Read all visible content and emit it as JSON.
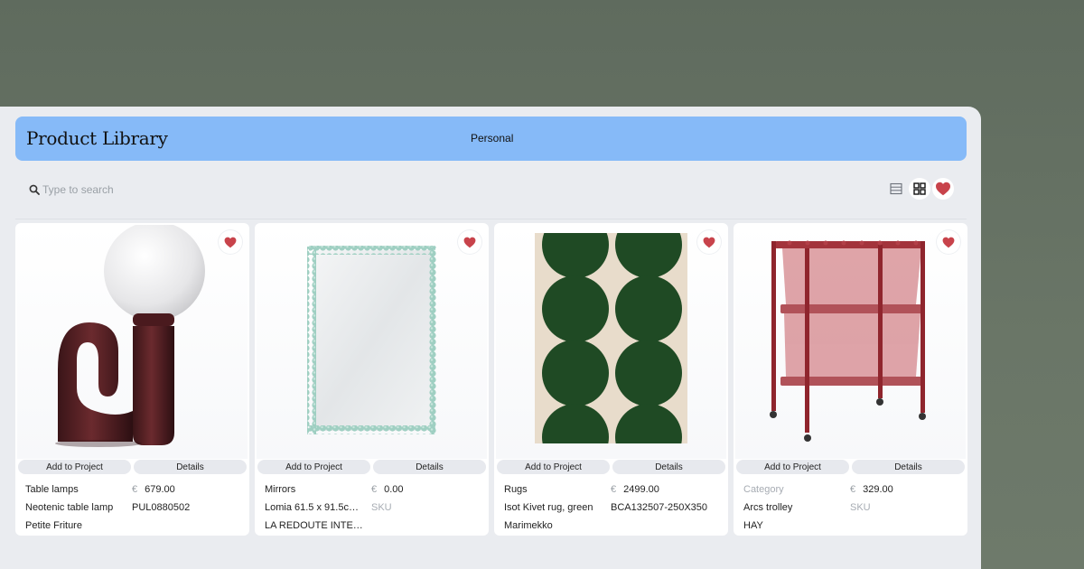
{
  "app": {
    "title": "Product Library",
    "mode": "Personal"
  },
  "search": {
    "placeholder": "Type to search",
    "value": ""
  },
  "colors": {
    "header": "#86baf8",
    "favorite": "#c8434b",
    "window": "#eaecf0"
  },
  "view_toggles": [
    {
      "icon": "list-view-icon",
      "active": false
    },
    {
      "icon": "grid-view-icon",
      "active": true
    },
    {
      "icon": "heart-filter-icon",
      "active": false
    }
  ],
  "actions": {
    "add": "Add to Project",
    "details": "Details"
  },
  "products": [
    {
      "category": "Table lamps",
      "currency": "€",
      "price": "679.00",
      "name": "Neotenic table lamp",
      "sku": "PUL0880502",
      "brand": "Petite Friture",
      "favorite": true,
      "image": "table-lamp-image"
    },
    {
      "category": "Mirrors",
      "currency": "€",
      "price": "0.00",
      "name": "Lomia 61.5 x 91.5cm L...",
      "sku": "SKU",
      "brand": "LA REDOUTE INTERIE...",
      "favorite": true,
      "image": "mirror-image"
    },
    {
      "category": "Rugs",
      "currency": "€",
      "price": "2499.00",
      "name": "Isot Kivet rug, green",
      "sku": "BCA132507-250X350",
      "brand": "Marimekko",
      "favorite": true,
      "image": "rug-image"
    },
    {
      "category": "Category",
      "currency": "€",
      "price": "329.00",
      "name": "Arcs trolley",
      "sku": "SKU",
      "brand": "HAY",
      "favorite": true,
      "image": "trolley-image"
    }
  ]
}
